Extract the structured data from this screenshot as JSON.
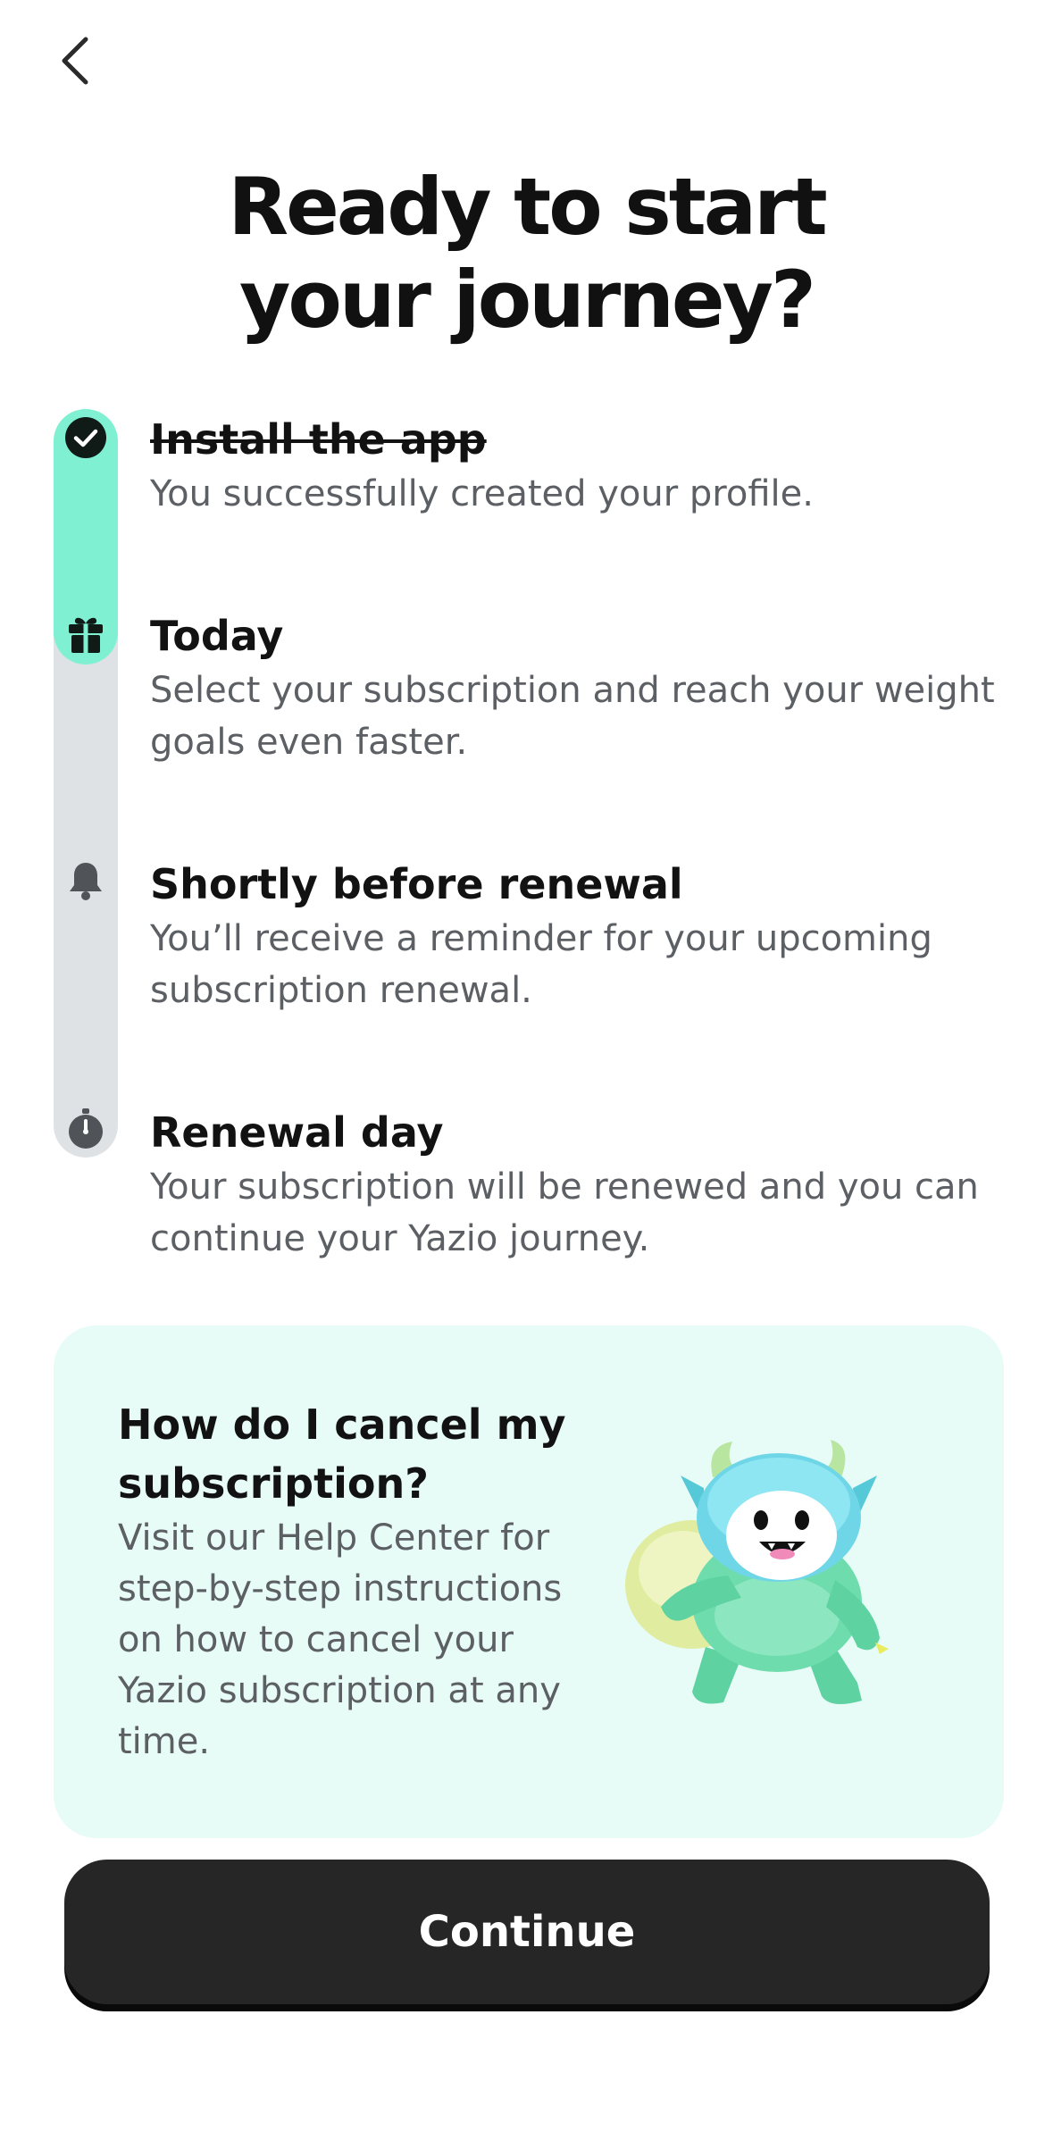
{
  "header": {
    "back_icon": "chevron-left-icon",
    "title_line1": "Ready to start",
    "title_line2": "your journey?"
  },
  "timeline": {
    "progress_color": "#7ff1d2",
    "track_color": "#dfe2e5",
    "steps": [
      {
        "icon": "check-circle-icon",
        "title": "Install the app",
        "completed": true,
        "description": "You successfully created your profile."
      },
      {
        "icon": "gift-icon",
        "title": "Today",
        "completed": false,
        "description": "Select your subscription and reach your weight goals even faster."
      },
      {
        "icon": "bell-icon",
        "title": "Shortly before renewal",
        "completed": false,
        "description": "You’ll receive a reminder for your upcoming subscription renewal."
      },
      {
        "icon": "stopwatch-icon",
        "title": "Renewal day",
        "completed": false,
        "description": "Your subscription will be renewed and you can continue your Yazio journey."
      }
    ]
  },
  "help_card": {
    "title": "How do I cancel my subscription?",
    "description": "Visit our Help Center for step-by-step instructions on how to cancel your Yazio subscription at any time.",
    "illustration": "yeti-mascot-with-sack",
    "background": "#e8fcf7"
  },
  "footer": {
    "continue_label": "Continue"
  }
}
